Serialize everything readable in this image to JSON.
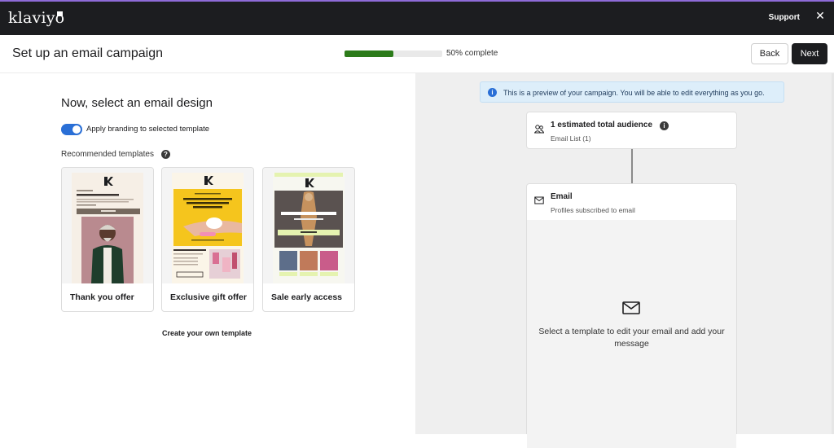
{
  "topbar": {
    "logo": "klaviyo",
    "support_label": "Support",
    "close_symbol": "✕"
  },
  "header": {
    "title": "Set up an email campaign",
    "progress_percent": 50,
    "progress_label": "50% complete",
    "back_label": "Back",
    "next_label": "Next"
  },
  "design": {
    "heading": "Now, select an email design",
    "branding_toggle_label": "Apply branding to selected template",
    "branding_toggle_on": true,
    "recommended_label": "Recommended templates",
    "help_symbol": "?",
    "templates": [
      {
        "label": "Thank you offer",
        "subject": "15% off + free 2-day shipping"
      },
      {
        "label": "Exclusive gift offer",
        "subject": "Free cloud moisturizer with any purchase. You, any!"
      },
      {
        "label": "Sale early access",
        "subject": "FREE shipping + 20% OFF"
      }
    ],
    "create_own_label": "Create your own template"
  },
  "preview": {
    "info_text": "This is a preview of your campaign. You will be able to edit everything as you go.",
    "info_symbol": "i",
    "audience": {
      "title": "1 estimated total audience",
      "subtitle": "Email List (1)",
      "info_symbol": "i"
    },
    "email": {
      "title": "Email",
      "subtitle": "Profiles subscribed to email",
      "empty_message": "Select a template to edit your email and add your message"
    }
  },
  "colors": {
    "topbar_bg": "#1c1d20",
    "accent_line": "#8e6bd8",
    "progress_fill": "#2c7b1a",
    "toggle_on": "#2a6fd6",
    "info_bg": "#ddeefa",
    "preview_bg": "#efefef"
  }
}
